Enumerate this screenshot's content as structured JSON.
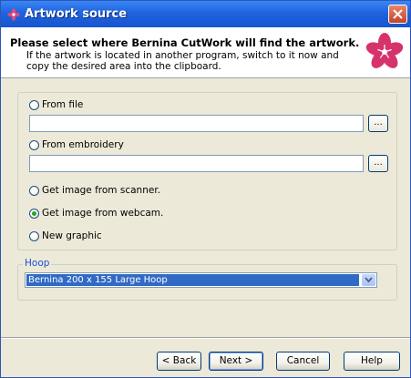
{
  "window": {
    "title": "Artwork source",
    "title_icon": "flower-icon",
    "close_icon": "close-icon"
  },
  "header": {
    "title": "Please select where Bernina CutWork will find the artwork.",
    "description": "If the artwork is located in another program, switch to it now and copy the desired area into the clipboard.",
    "logo": "flower-logo"
  },
  "source": {
    "options": [
      {
        "label": "From file",
        "checked": false
      },
      {
        "label": "From embroidery",
        "checked": false
      },
      {
        "label": "Get image from scanner.",
        "checked": false
      },
      {
        "label": "Get image from webcam.",
        "checked": true
      },
      {
        "label": "New graphic",
        "checked": false
      }
    ],
    "file_path": "",
    "embroidery_path": "",
    "browse_label": "..."
  },
  "hoop": {
    "label": "Hoop",
    "selected": "Bernina 200 x 155 Large Hoop"
  },
  "buttons": {
    "back": "< Back",
    "next": "Next >",
    "cancel": "Cancel",
    "help": "Help"
  },
  "colors": {
    "title_bar": "#1f63df",
    "accent_flower": "#d6336c",
    "group_label": "#1c4fd8",
    "selection": "#316ac5"
  }
}
